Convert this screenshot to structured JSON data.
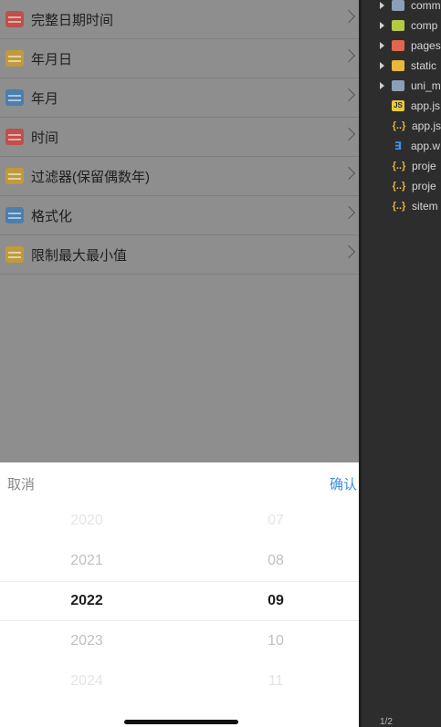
{
  "list": {
    "items": [
      {
        "label": "完整日期时间",
        "icon": "calendar-clock-icon",
        "color": "#c0504d"
      },
      {
        "label": "年月日",
        "icon": "calendar-grid-icon",
        "color": "#c19a3c"
      },
      {
        "label": "年月",
        "icon": "calendar-month-icon",
        "color": "#4a7fae"
      },
      {
        "label": "时间",
        "icon": "clock-icon",
        "color": "#c0504d"
      },
      {
        "label": "过滤器(保留偶数年)",
        "icon": "calendar-filter-icon",
        "color": "#c19a3c"
      },
      {
        "label": "格式化",
        "icon": "calendar-format-icon",
        "color": "#4a7fae"
      },
      {
        "label": "限制最大最小值",
        "icon": "calendar-limit-icon",
        "color": "#c19a3c"
      }
    ]
  },
  "picker": {
    "cancel_label": "取消",
    "confirm_label": "确认",
    "years": [
      "2020",
      "2021",
      "2022",
      "2023",
      "2024"
    ],
    "months": [
      "07",
      "08",
      "09",
      "10",
      "11"
    ],
    "selected_index": 2
  },
  "explorer": {
    "items": [
      {
        "name": "comm",
        "type": "folder",
        "icon": "folder-icon",
        "color": "#8aa0b4"
      },
      {
        "name": "comp",
        "type": "folder",
        "icon": "components-folder-icon",
        "color": "#b5c942"
      },
      {
        "name": "pages",
        "type": "folder",
        "icon": "pages-folder-icon",
        "color": "#e0664f"
      },
      {
        "name": "static",
        "type": "folder",
        "icon": "static-folder-icon",
        "color": "#e8b73c"
      },
      {
        "name": "uni_m",
        "type": "folder",
        "icon": "folder-icon",
        "color": "#8aa0b4"
      },
      {
        "name": "app.js",
        "type": "js",
        "icon": "js-file-icon",
        "color": "#e8c93c"
      },
      {
        "name": "app.js",
        "type": "json",
        "icon": "json-file-icon",
        "color": "#e8b73c"
      },
      {
        "name": "app.w",
        "type": "css",
        "icon": "css-file-icon",
        "color": "#3f8ee8"
      },
      {
        "name": "proje",
        "type": "json",
        "icon": "json-file-icon",
        "color": "#e8b73c"
      },
      {
        "name": "proje",
        "type": "json",
        "icon": "json-file-icon",
        "color": "#e8b73c"
      },
      {
        "name": "sitem",
        "type": "json",
        "icon": "json-file-icon",
        "color": "#e8b73c"
      }
    ],
    "bottom_label": "1/2"
  }
}
